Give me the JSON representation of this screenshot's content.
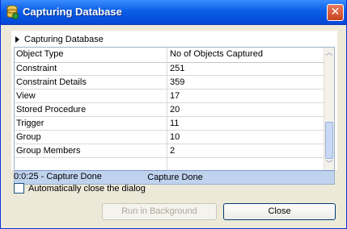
{
  "window": {
    "title": "Capturing Database"
  },
  "section": {
    "label": "Capturing Database"
  },
  "table": {
    "headers": [
      "Object Type",
      "No of Objects Captured"
    ],
    "rows": [
      [
        "Constraint",
        "251"
      ],
      [
        "Constraint Details",
        "359"
      ],
      [
        "View",
        "17"
      ],
      [
        "Stored Procedure",
        "20"
      ],
      [
        "Trigger",
        "11"
      ],
      [
        "Group",
        "10"
      ],
      [
        "Group Members",
        "2"
      ]
    ]
  },
  "status": {
    "text": "Capture Done"
  },
  "elapsed": {
    "text": "0:0:25 - Capture Done"
  },
  "auto_close": {
    "label": "Automatically close the dialog",
    "checked": false
  },
  "buttons": {
    "run_background": "Run in Background",
    "close": "Close"
  }
}
